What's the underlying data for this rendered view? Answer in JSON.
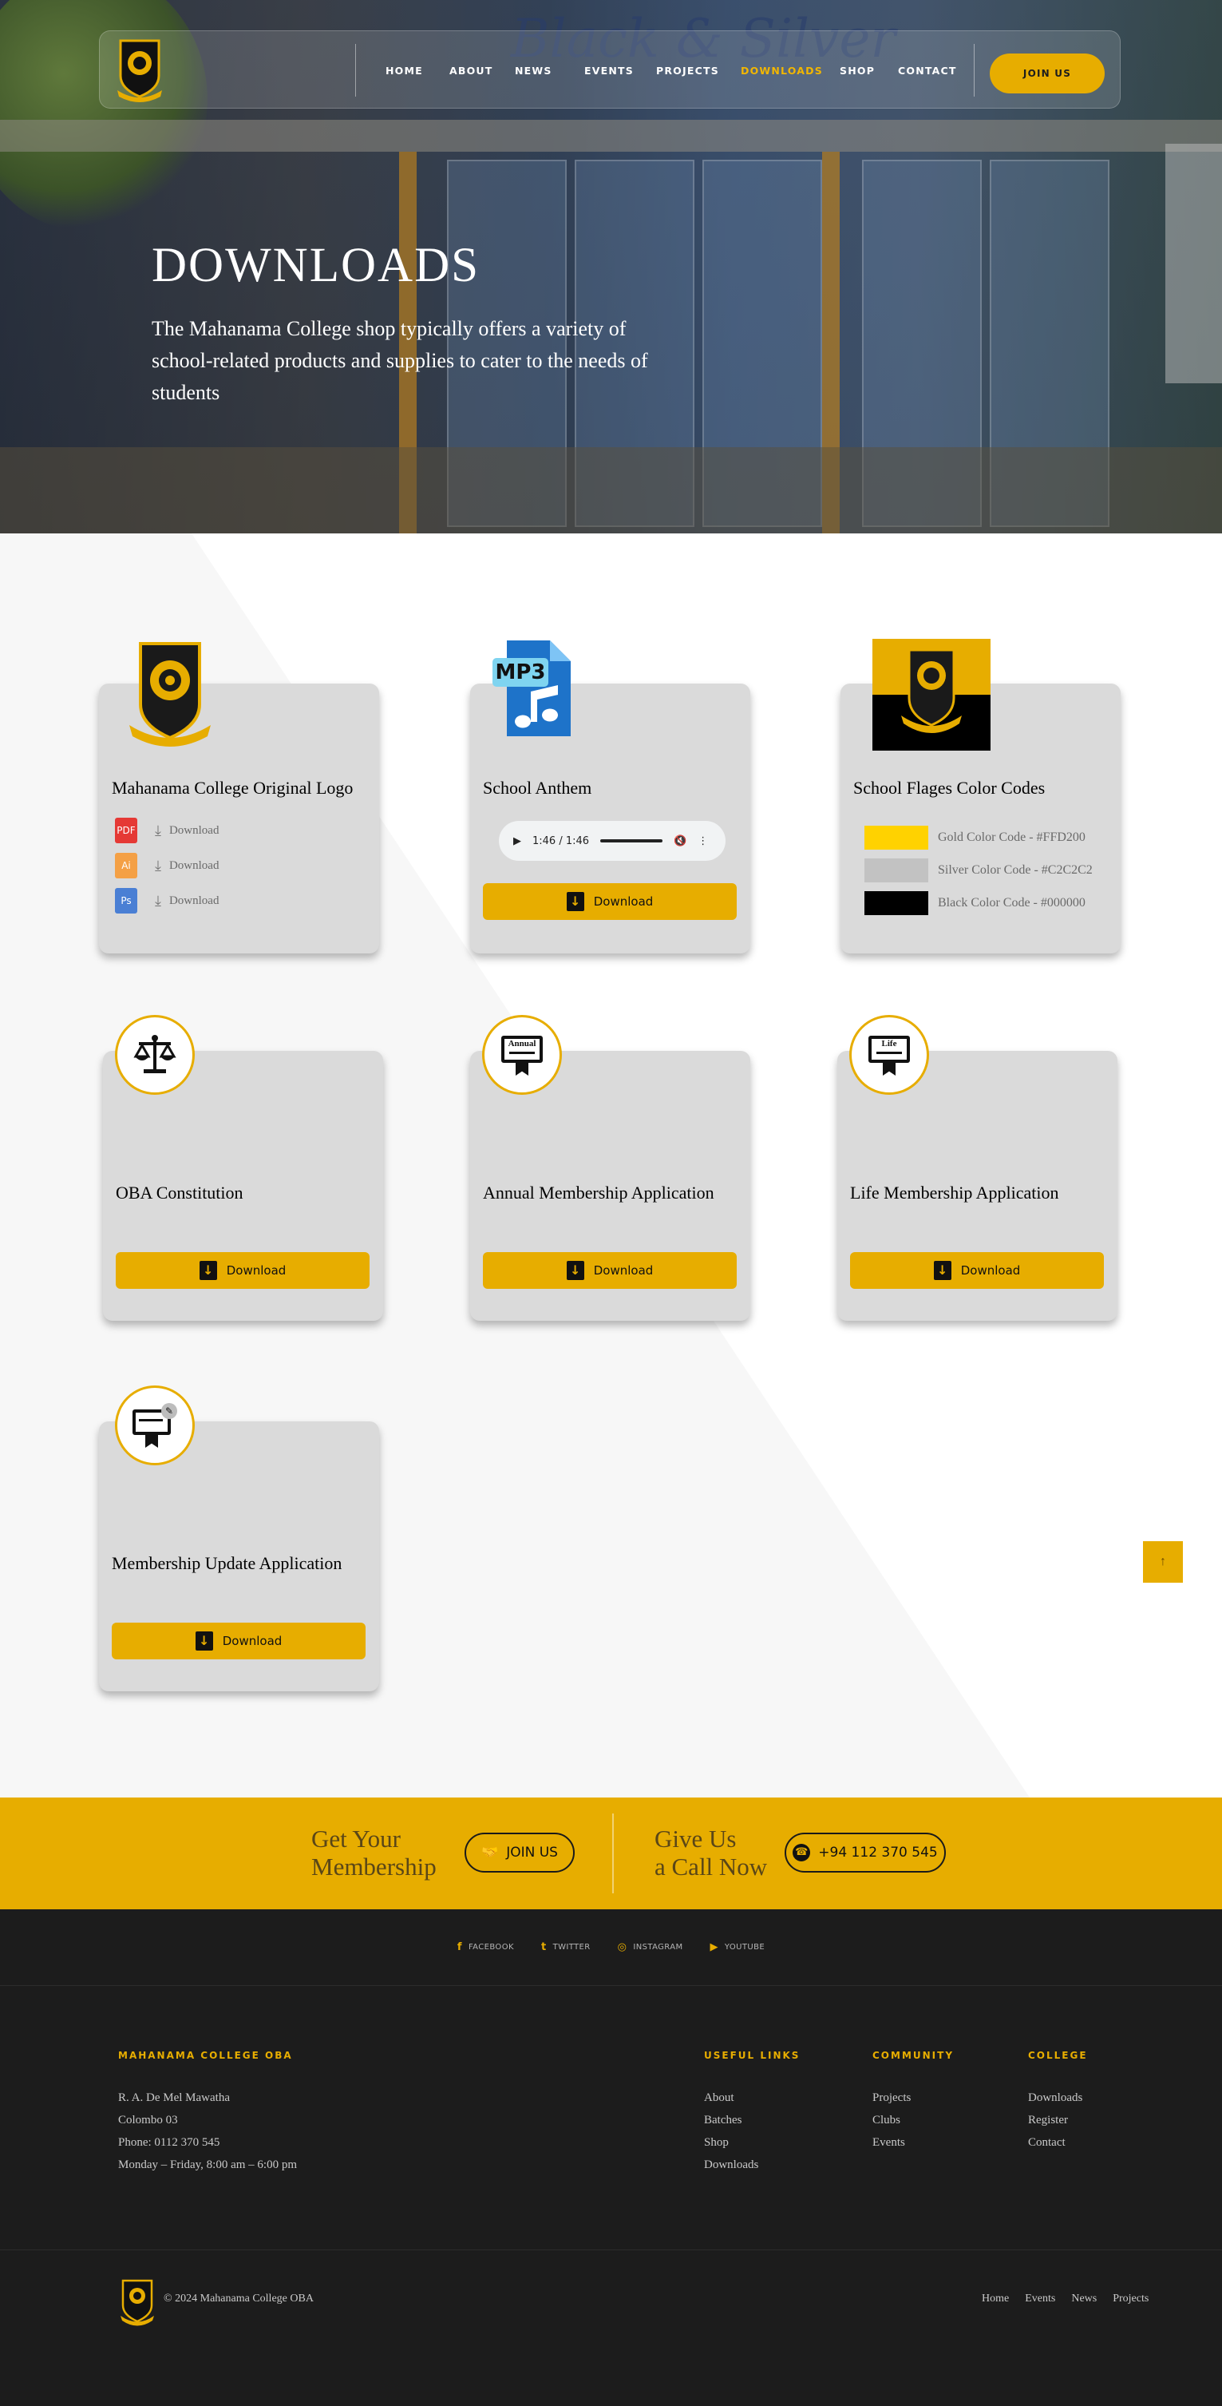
{
  "nav": {
    "items": [
      {
        "label": "HOME"
      },
      {
        "label": "ABOUT"
      },
      {
        "label": "NEWS"
      },
      {
        "label": "EVENTS"
      },
      {
        "label": "PROJECTS"
      },
      {
        "label": "DOWNLOADS"
      },
      {
        "label": "SHOP"
      },
      {
        "label": "CONTACT"
      }
    ],
    "active": "DOWNLOADS",
    "join_label": "JOIN US"
  },
  "hero": {
    "title": "DOWNLOADS",
    "subtitle": "The Mahanama College shop typically offers a variety of school-related products and supplies to cater to the needs of students",
    "sign_text": "Black & Silver"
  },
  "cards": {
    "logo": {
      "title": "Mahanama College Original Logo",
      "files": [
        {
          "type": "PDF",
          "label": "Download",
          "color": "#e53935"
        },
        {
          "type": "Ai",
          "label": "Download",
          "color": "#f4a045"
        },
        {
          "type": "Ps",
          "label": "Download",
          "color": "#4a7fd4"
        }
      ]
    },
    "anthem": {
      "title": "School Anthem",
      "badge": "MP3",
      "audio_time": "1:46 / 1:46",
      "download_label": "Download"
    },
    "colors": {
      "title": "School Flages Color Codes",
      "swatches": [
        {
          "label": "Gold Color Code - #FFD200",
          "color": "#FFD200"
        },
        {
          "label": "Silver Color Code - #C2C2C2",
          "color": "#C2C2C2"
        },
        {
          "label": "Black Color Code - #000000",
          "color": "#000000"
        }
      ]
    },
    "constitution": {
      "title": "OBA Constitution",
      "icon": "scales-icon",
      "download_label": "Download"
    },
    "annual": {
      "title": "Annual Membership Application",
      "icon_text": "Annual",
      "download_label": "Download"
    },
    "life": {
      "title": "Life Membership Application",
      "icon_text": "Life",
      "download_label": "Download"
    },
    "update": {
      "title": "Membership Update Application",
      "icon": "certificate-edit-icon",
      "download_label": "Download"
    }
  },
  "to_top": "↑",
  "cta": {
    "left_text": "Get Your Membership",
    "left_line1": "Get Your",
    "left_line2": "Membership",
    "join_label": "JOIN US",
    "right_line1": "Give Us",
    "right_line2": "a Call Now",
    "phone": "+94 112 370 545"
  },
  "footer": {
    "social": [
      {
        "icon": "facebook-icon",
        "glyph": "f",
        "label": "FACEBOOK"
      },
      {
        "icon": "twitter-icon",
        "glyph": "t",
        "label": "TWITTER"
      },
      {
        "icon": "instagram-icon",
        "glyph": "◎",
        "label": "INSTAGRAM"
      },
      {
        "icon": "youtube-icon",
        "glyph": "▶",
        "label": "YOUTUBE"
      }
    ],
    "org_heading": "MAHANAMA COLLEGE OBA",
    "address": [
      "R. A. De Mel Mawatha",
      "Colombo 03",
      "Phone: 0112 370 545",
      "Monday – Friday, 8:00 am – 6:00 pm"
    ],
    "columns": [
      {
        "heading": "USEFUL LINKS",
        "links": [
          "About",
          "Batches",
          "Shop",
          "Downloads"
        ]
      },
      {
        "heading": "COMMUNITY",
        "links": [
          "Projects",
          "Clubs",
          "Events"
        ]
      },
      {
        "heading": "COLLEGE",
        "links": [
          "Downloads",
          "Register",
          "Contact"
        ]
      }
    ],
    "copyright": "© 2024 Mahanama College OBA",
    "bottom_links": [
      "Home",
      "Events",
      "News",
      "Projects"
    ]
  },
  "colors": {
    "accent": "#e7ad00",
    "footer_bg": "#1c1c1c"
  }
}
